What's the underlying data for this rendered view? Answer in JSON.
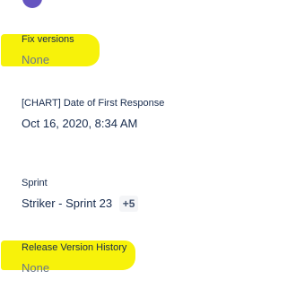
{
  "fields": {
    "fix_versions": {
      "label": "Fix versions",
      "value": "None"
    },
    "first_response": {
      "label": "[CHART] Date of First Response",
      "value": "Oct 16, 2020, 8:34 AM"
    },
    "sprint": {
      "label": "Sprint",
      "value": "Striker - Sprint 23",
      "more": "+5"
    },
    "release_history": {
      "label": "Release Version History",
      "value": "None"
    }
  },
  "colors": {
    "highlight": "#f7f20a",
    "text": "#172b4d",
    "muted": "#6b778c",
    "avatar": "#6554c0"
  }
}
